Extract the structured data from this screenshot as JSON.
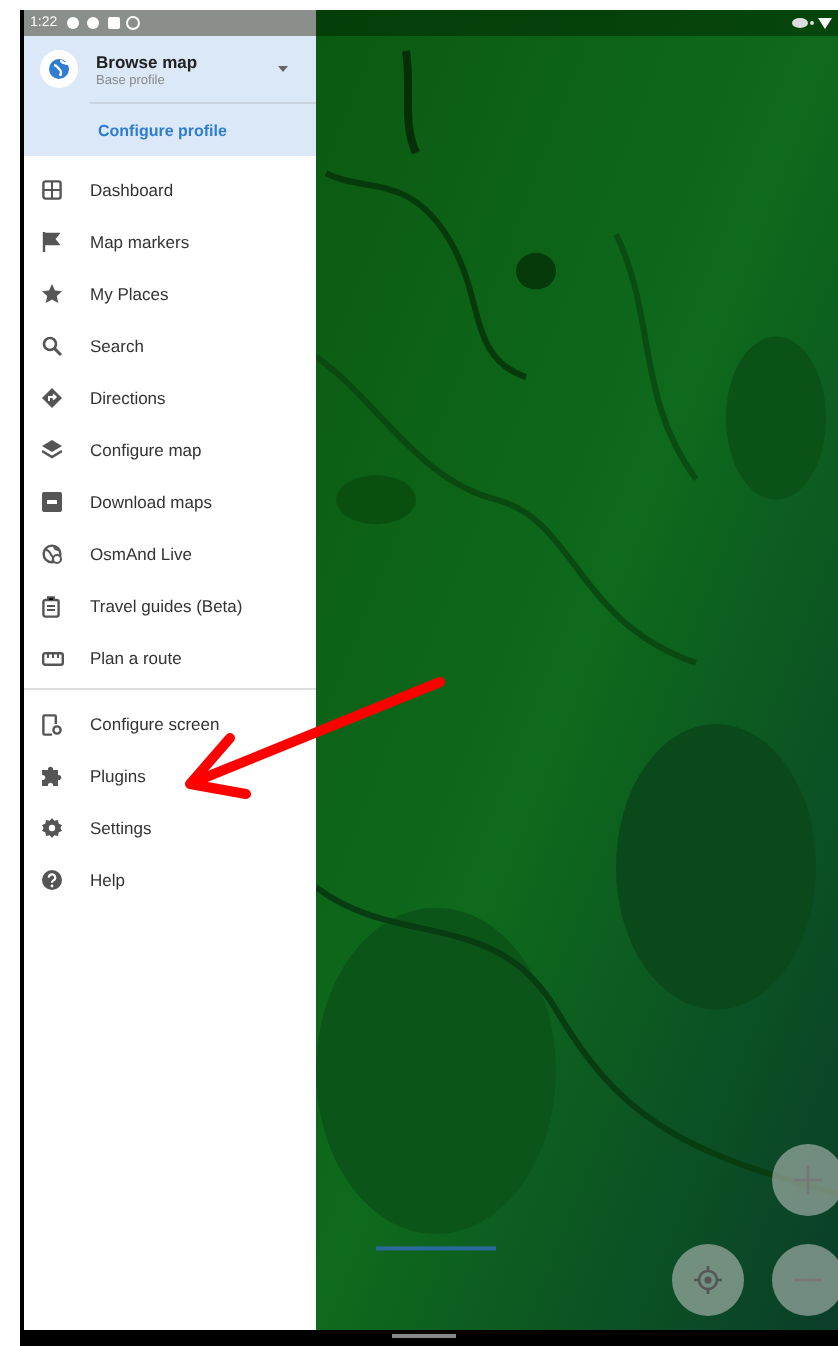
{
  "status_bar": {
    "time": "1:22"
  },
  "profile": {
    "title": "Browse map",
    "subtitle": "Base profile",
    "action": "Configure profile"
  },
  "menu_sections": [
    {
      "items": [
        {
          "label": "Dashboard"
        },
        {
          "label": "Map markers"
        },
        {
          "label": "My Places"
        },
        {
          "label": "Search"
        },
        {
          "label": "Directions"
        },
        {
          "label": "Configure map"
        },
        {
          "label": "Download maps"
        },
        {
          "label": "OsmAnd Live"
        },
        {
          "label": "Travel guides (Beta)"
        },
        {
          "label": "Plan a route"
        }
      ]
    },
    {
      "items": [
        {
          "label": "Configure screen"
        },
        {
          "label": "Plugins"
        },
        {
          "label": "Settings"
        },
        {
          "label": "Help"
        }
      ]
    }
  ]
}
